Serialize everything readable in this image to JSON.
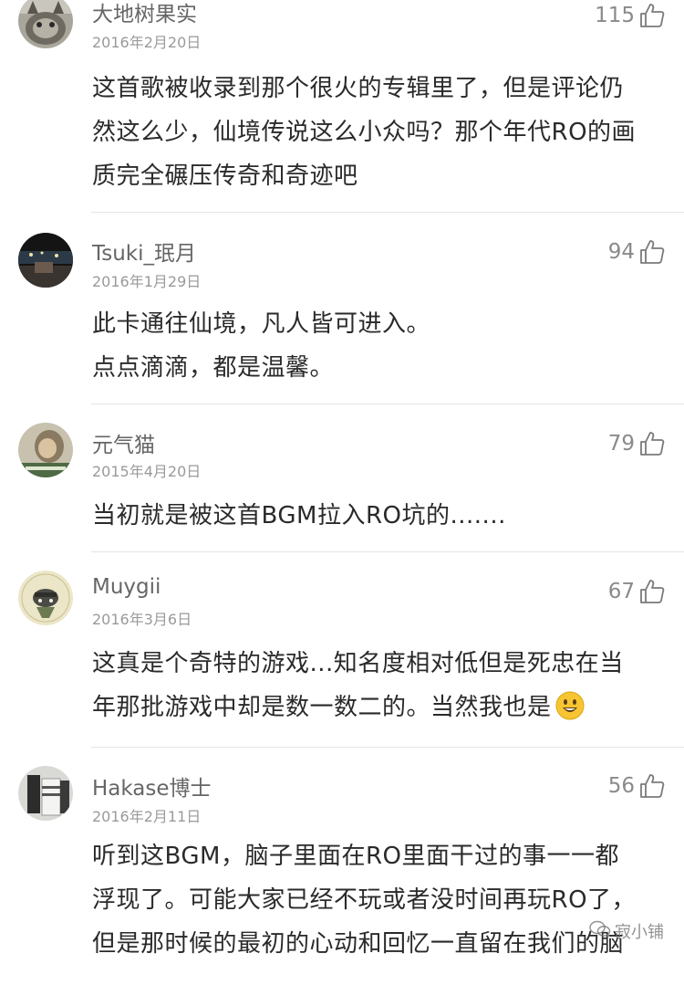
{
  "comments": [
    {
      "user": "大地树果实",
      "date": "2016年2月20日",
      "likes": "115",
      "text": "这首歌被收录到那个很火的专辑里了，但是评论仍\n然这么少，仙境传说这么小众吗？那个年代RO的画\n质完全碾压传奇和奇迹吧",
      "avatar": "cat-avatar"
    },
    {
      "user": "Tsuki_珉月",
      "date": "2016年1月29日",
      "likes": "94",
      "text": "此卡通往仙境，凡人皆可进入。\n点点滴滴，都是温馨。",
      "avatar": "night-scene-avatar"
    },
    {
      "user": "元气猫",
      "date": "2015年4月20日",
      "likes": "79",
      "text": "当初就是被这首BGM拉入RO坑的.......",
      "avatar": "photo-avatar"
    },
    {
      "user": "Muygii",
      "date": "2016年3月6日",
      "likes": "67",
      "text": "这真是个奇特的游戏...知名度相对低但是死忠在当\n年那批游戏中却是数一数二的。当然我也是",
      "avatar": "cartoon-avatar"
    },
    {
      "user": "Hakase博士",
      "date": "2016年2月11日",
      "likes": "56",
      "text": "听到这BGM，脑子里面在RO里面干过的事一一都\n浮现了。可能大家已经不玩或者没时间再玩RO了，\n但是那时候的最初的心动和回忆一直留在我们的脑",
      "avatar": "jersey-avatar"
    }
  ],
  "watermark": "寂小铺",
  "icons": {
    "like": "thumbs-up-icon",
    "emoji": "smile-emoji-icon",
    "watermark": "wechat-icon"
  },
  "colors": {
    "text": "#2a2a2a",
    "meta": "#9a9a9a",
    "divider": "#e4e4e4"
  }
}
